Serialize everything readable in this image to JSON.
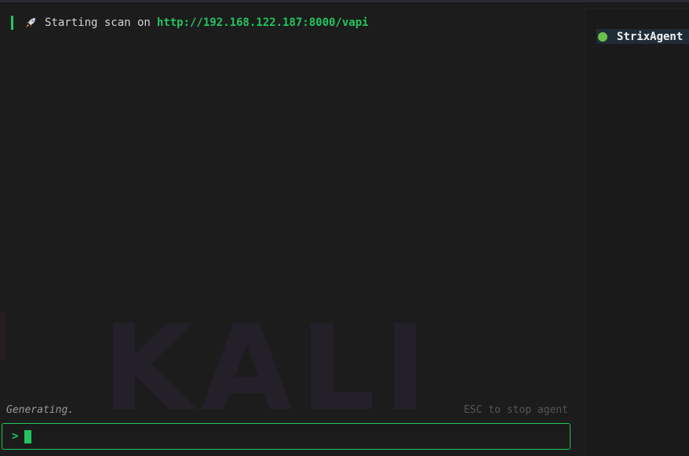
{
  "chat": {
    "message": {
      "icon": "rocket-icon",
      "text": "Starting scan on",
      "url": "http://192.168.122.187:8000/vapi"
    },
    "watermark": "KALI",
    "status": {
      "generating": "Generating.",
      "hint": "ESC to stop agent"
    },
    "input": {
      "prompt": ">",
      "value": ""
    }
  },
  "agents": {
    "items": [
      {
        "name": "StrixAgent",
        "status": "running"
      }
    ]
  },
  "colors": {
    "accent": "#22c55e",
    "background": "#1b1b1b",
    "agent_status": "#6cc04a",
    "agent_highlight": "#1f2c37"
  }
}
